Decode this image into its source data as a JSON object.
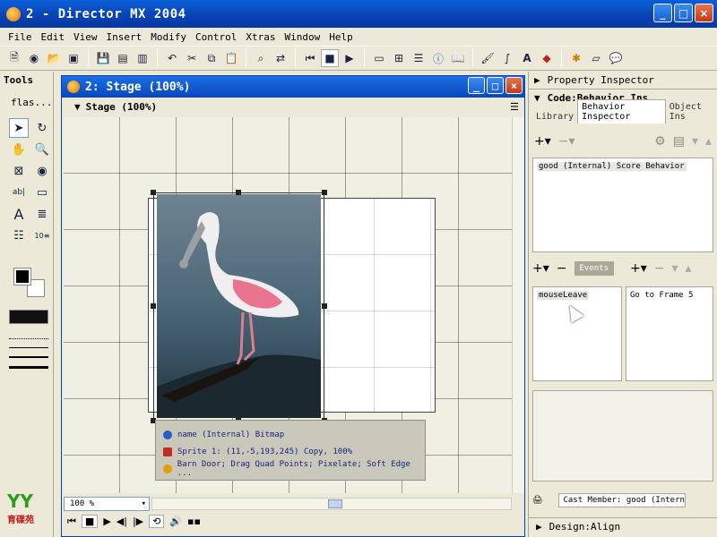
{
  "app": {
    "title": "2 - Director MX 2004",
    "window_buttons": [
      "_",
      "□",
      "×"
    ]
  },
  "menu": [
    "File",
    "Edit",
    "View",
    "Insert",
    "Modify",
    "Control",
    "Xtras",
    "Window",
    "Help"
  ],
  "toolbar": {
    "icons": [
      "new-movie-icon",
      "new-cast-icon",
      "open-icon",
      "import-icon",
      "save-icon",
      "save-all-icon",
      "publish-icon",
      "undo-icon",
      "cut-icon",
      "copy-icon",
      "paste-icon",
      "find-icon",
      "exchange-icon",
      "rewind-icon",
      "stop-icon",
      "play-icon",
      "stage-icon",
      "cast-window-icon",
      "score-icon",
      "property-inspector-icon",
      "library-icon",
      "paint-icon",
      "vector-icon",
      "text-icon",
      "shockwave3d-icon",
      "script-icon",
      "message-icon",
      "behavior-inspector-icon"
    ]
  },
  "tools": {
    "title": "Tools",
    "dropdown_label": "flas..."
  },
  "stage_window": {
    "title": "2: Stage (100%)",
    "panel_header": "Stage (100%)",
    "zoom": "100 %"
  },
  "sprite_info": {
    "name_line": "name (Internal) Bitmap",
    "sprite_line": "Sprite 1: (11,-5,193,245) Copy, 100%",
    "effects_line": "Barn Door; Drag Quad Points; Pixelate; Soft Edge ..."
  },
  "right_panel": {
    "property_inspector": "Property Inspector",
    "code_header": "Code:Behavior Ins...",
    "tabs": [
      "Library",
      "Behavior Inspector",
      "Object Ins"
    ],
    "behaviors": [
      "good (Internal) Score Behavior"
    ],
    "events_label": "Events",
    "events": [
      "mouseLeave"
    ],
    "actions": [
      "Go to Frame 5"
    ],
    "cast_member_label": "Cast Member:",
    "cast_member_value": "good (Interna",
    "design_header": "Design:Align"
  },
  "colors": {
    "title_bar": "#0842b5",
    "chrome": "#ece9d8",
    "stage_bg": "#f0efe3"
  }
}
